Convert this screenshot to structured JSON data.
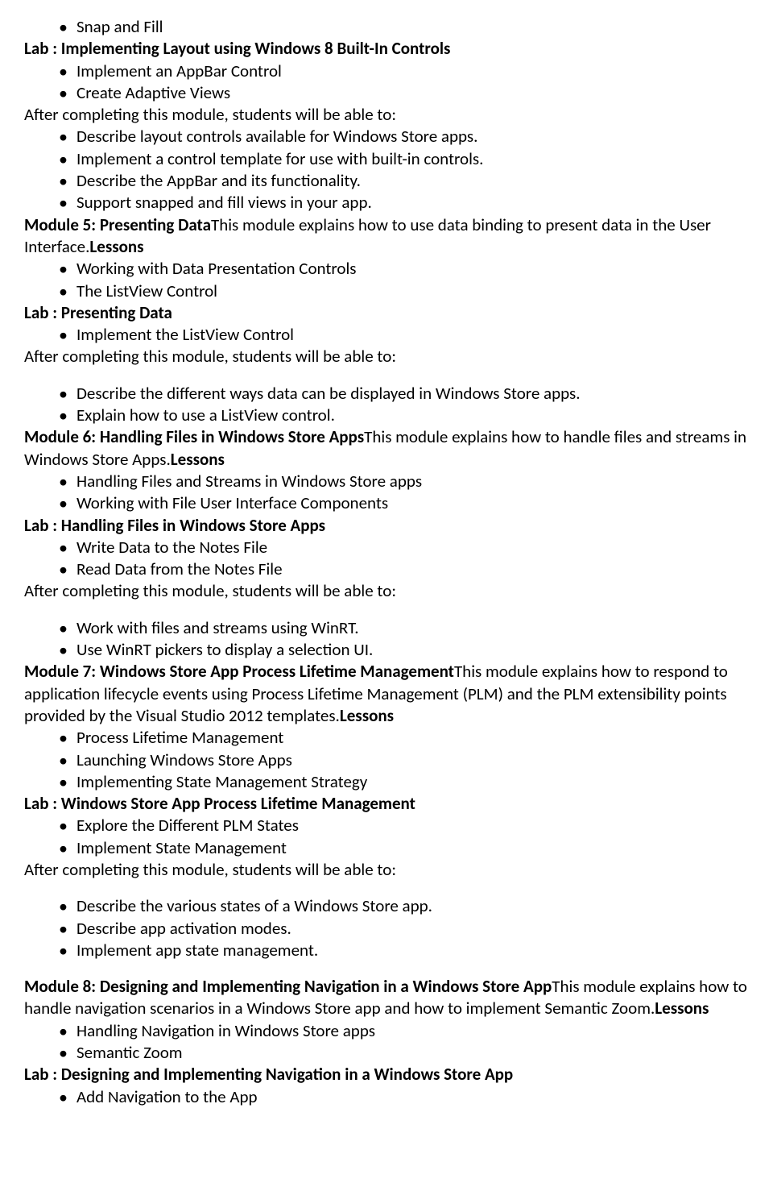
{
  "block0": {
    "li1": "Snap and Fill",
    "lab": "Lab : Implementing Layout using Windows 8 Built-In Controls",
    "li2": "Implement an AppBar Control",
    "li3": "Create Adaptive Views",
    "after": "After completing this module, students will be able to:",
    "li4": "Describe layout controls available for Windows Store apps.",
    "li5": "Implement a control template for use with built-in controls.",
    "li6": "Describe the AppBar and its functionality.",
    "li7": "Support snapped and fill views in your app."
  },
  "m5": {
    "titleBold": "Module 5: Presenting Data",
    "titleRest": "This module explains how to use data binding to present data in the User Interface.",
    "lessonsBold": "Lessons",
    "li1": "Working with Data Presentation Controls",
    "li2": "The ListView Control",
    "lab": "Lab : Presenting Data",
    "li3": "Implement the ListView Control",
    "after": "After completing this module, students will be able to:",
    "li4": "Describe the different ways data can be displayed in Windows Store apps.",
    "li5": "Explain how to use a ListView control."
  },
  "m6": {
    "titleBold": "Module 6: Handling Files in Windows Store Apps",
    "titleRest": "This module explains how to handle files and streams in Windows Store Apps.",
    "lessonsBold": "Lessons",
    "li1": "Handling Files and Streams in Windows Store apps",
    "li2": "Working with File User Interface Components",
    "lab": "Lab : Handling Files in Windows Store Apps",
    "li3": "Write Data to the Notes File",
    "li4": "Read Data from the Notes File",
    "after": "After completing this module, students will be able to:",
    "li5": "Work with files and streams using WinRT.",
    "li6": "Use WinRT pickers to display a selection UI."
  },
  "m7": {
    "titleBold": "Module 7: Windows Store App Process Lifetime Management",
    "titleRest": "This module explains how to respond to application lifecycle events using Process Lifetime Management (PLM) and the PLM extensibility points provided by the Visual Studio 2012 templates.",
    "lessonsBold": "Lessons",
    "li1": "Process Lifetime Management",
    "li2": "Launching Windows Store Apps",
    "li3": "Implementing State Management Strategy",
    "lab": "Lab : Windows Store App Process Lifetime Management",
    "li4": "Explore the Different PLM States",
    "li5": "Implement State Management",
    "after": "After completing this module, students will be able to:",
    "li6": "Describe the various states of a Windows Store app.",
    "li7": "Describe app activation modes.",
    "li8": "Implement app state management."
  },
  "m8": {
    "titleBold": "Module 8: Designing and Implementing Navigation in a Windows Store App",
    "titleRest": "This module explains how to handle navigation scenarios in a Windows Store app and how to implement Semantic Zoom.",
    "lessonsBold": "Lessons",
    "li1": "Handling Navigation in Windows Store apps",
    "li2": "Semantic Zoom",
    "lab": "Lab : Designing and Implementing Navigation in a Windows Store App",
    "li3": "Add Navigation to the App"
  }
}
